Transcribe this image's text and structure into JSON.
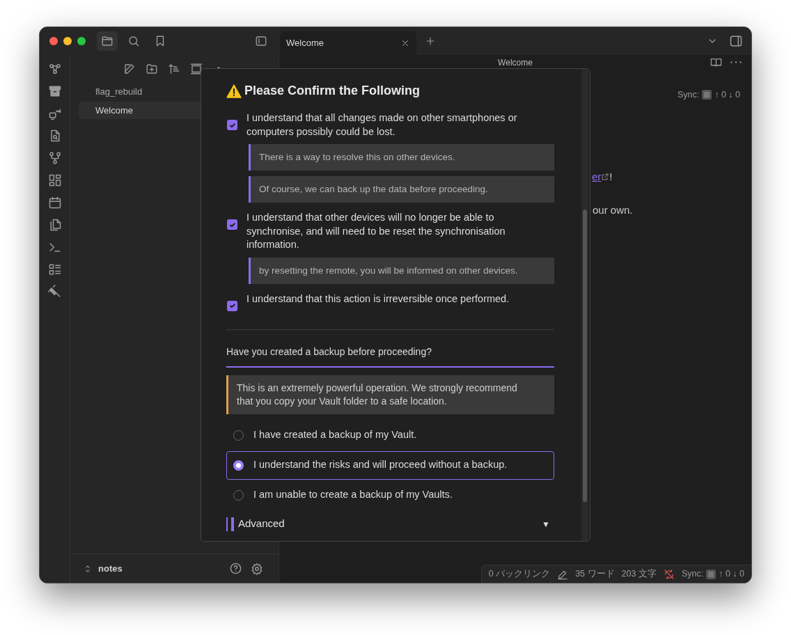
{
  "tab_bar": {
    "tabs": [
      {
        "title": "Welcome",
        "selected": true
      }
    ]
  },
  "file_explorer": {
    "items": [
      {
        "label": "flag_rebuild",
        "selected": false
      },
      {
        "label": "Welcome",
        "selected": true
      }
    ],
    "vault": "notes"
  },
  "editor": {
    "title": "Welcome",
    "sync": {
      "label": "Sync:",
      "counts": "↑ 0 ↓ 0"
    },
    "link_fragment": "er",
    "after_link": "!",
    "line_fragment": "our own."
  },
  "modal": {
    "title": "Please Confirm the Following",
    "confirmations": [
      {
        "text": "I understand that all changes made on other smartphones or computers possibly could be lost.",
        "checked": true,
        "notes": [
          "There is a way to resolve this on other devices.",
          "Of course, we can back up the data before proceeding."
        ]
      },
      {
        "text": "I understand that other devices will no longer be able to synchronise, and will need to be reset the synchronisation information.",
        "checked": true,
        "notes": [
          "by resetting the remote, you will be informed on other devices."
        ]
      },
      {
        "text": "I understand that this action is irreversible once performed.",
        "checked": true
      }
    ],
    "backup": {
      "question": "Have you created a backup before proceeding?",
      "warning": "This is an extremely powerful operation. We strongly recommend that you copy your Vault folder to a safe location.",
      "options": [
        {
          "label": "I have created a backup of my Vault.",
          "selected": false
        },
        {
          "label": "I understand the risks and will proceed without a backup.",
          "selected": true
        },
        {
          "label": "I am unable to create a backup of my Vaults.",
          "selected": false
        }
      ]
    },
    "advanced": {
      "label": "Advanced",
      "toggle": "▼"
    }
  },
  "status_bar": {
    "items": [
      "0 バックリンク",
      "35 ワード",
      "203 文字"
    ],
    "sync": {
      "label": "Sync:",
      "counts": "↑ 0 ↓ 0"
    }
  }
}
